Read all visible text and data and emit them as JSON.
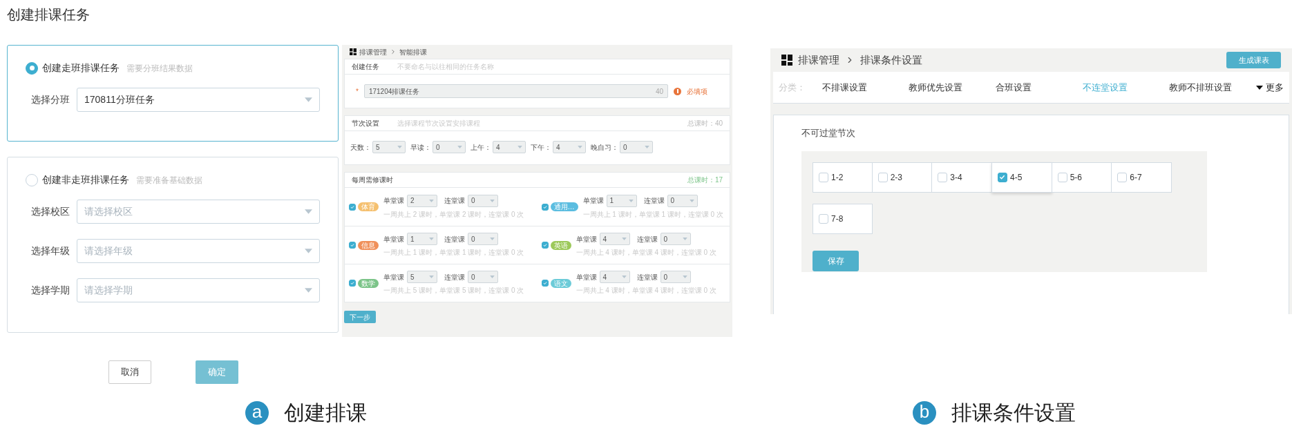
{
  "page_title": "创建排课任务",
  "create_form": {
    "options": [
      {
        "label": "创建走班排课任务",
        "hint": "需要分班结果数据",
        "selected": true,
        "fields": [
          {
            "label": "选择分班",
            "value": "170811分班任务"
          }
        ]
      },
      {
        "label": "创建非走班排课任务",
        "hint": "需要准备基础数据",
        "selected": false,
        "fields": [
          {
            "label": "选择校区",
            "placeholder": "请选择校区"
          },
          {
            "label": "选择年级",
            "placeholder": "请选择年级"
          },
          {
            "label": "选择学期",
            "placeholder": "请选择学期"
          }
        ]
      }
    ],
    "buttons": [
      {
        "label": "取消",
        "kind": "secondary"
      },
      {
        "label": "确定",
        "kind": "primary"
      }
    ]
  },
  "smart_schedule": {
    "breadcrumb": [
      "排课管理",
      "智能排课"
    ],
    "task": {
      "title": "创建任务",
      "hint": "不要命名与以往相同的任务名称",
      "required_mark": "*",
      "value": "171204排课任务",
      "counter": "40",
      "error": "必填项"
    },
    "periods": {
      "title": "节次设置",
      "hint": "选择课程节次设置安排课程",
      "total": "总课时：40",
      "fields": [
        {
          "label": "天数：",
          "value": "5"
        },
        {
          "label": "早读：",
          "value": "0"
        },
        {
          "label": "上午：",
          "value": "4"
        },
        {
          "label": "下午：",
          "value": "4"
        },
        {
          "label": "晚自习：",
          "value": "0"
        }
      ]
    },
    "hours": {
      "title": "每周需修课时",
      "total": "总课时：17",
      "subjects": [
        {
          "name": "体育",
          "color": "#f5c06f",
          "checked": true,
          "single_label": "单堂课",
          "single": "2",
          "double_label": "连堂课",
          "double": "0",
          "summary": "一周共上 2 课时，单堂课 2 课时，连堂课 0 次"
        },
        {
          "name": "通用…",
          "color": "#5bbde0",
          "checked": true,
          "single_label": "单堂课",
          "single": "1",
          "double_label": "连堂课",
          "double": "0",
          "summary": "一周共上 1 课时，单堂课 1 课时，连堂课 0 次"
        },
        {
          "name": "信息",
          "color": "#f0905a",
          "checked": true,
          "single_label": "单堂课",
          "single": "1",
          "double_label": "连堂课",
          "double": "0",
          "summary": "一周共上 1 课时，单堂课 1 课时，连堂课 0 次"
        },
        {
          "name": "英语",
          "color": "#9cc95a",
          "checked": true,
          "single_label": "单堂课",
          "single": "4",
          "double_label": "连堂课",
          "double": "0",
          "summary": "一周共上 4 课时，单堂课 4 课时，连堂课 0 次"
        },
        {
          "name": "数学",
          "color": "#7cc489",
          "checked": true,
          "single_label": "单堂课",
          "single": "5",
          "double_label": "连堂课",
          "double": "0",
          "summary": "一周共上 5 课时，单堂课 5 课时，连堂课 0 次"
        },
        {
          "name": "语文",
          "color": "#6ccbd8",
          "checked": true,
          "single_label": "单堂课",
          "single": "4",
          "double_label": "连堂课",
          "double": "0",
          "summary": "一周共上 4 课时，单堂课 4 课时，连堂课 0 次"
        }
      ]
    },
    "next": "下一步"
  },
  "conditions": {
    "breadcrumb": [
      "排课管理",
      "排课条件设置"
    ],
    "generate": "生成课表",
    "category_label": "分类：",
    "tabs": [
      {
        "label": "不排课设置",
        "selected": false
      },
      {
        "label": "教师优先设置",
        "selected": false
      },
      {
        "label": "合班设置",
        "selected": false
      },
      {
        "label": "不连堂设置",
        "selected": true
      },
      {
        "label": "教师不排班设置",
        "selected": false
      }
    ],
    "more": "更多",
    "section_title": "不可过堂节次",
    "slots": [
      {
        "label": "1-2",
        "checked": false
      },
      {
        "label": "2-3",
        "checked": false
      },
      {
        "label": "3-4",
        "checked": false
      },
      {
        "label": "4-5",
        "checked": true
      },
      {
        "label": "5-6",
        "checked": false
      },
      {
        "label": "6-7",
        "checked": false
      },
      {
        "label": "7-8",
        "checked": false
      }
    ],
    "save": "保存"
  },
  "captions": [
    {
      "letter": "a",
      "text": "创建排课"
    },
    {
      "letter": "b",
      "text": "排课条件设置"
    }
  ]
}
